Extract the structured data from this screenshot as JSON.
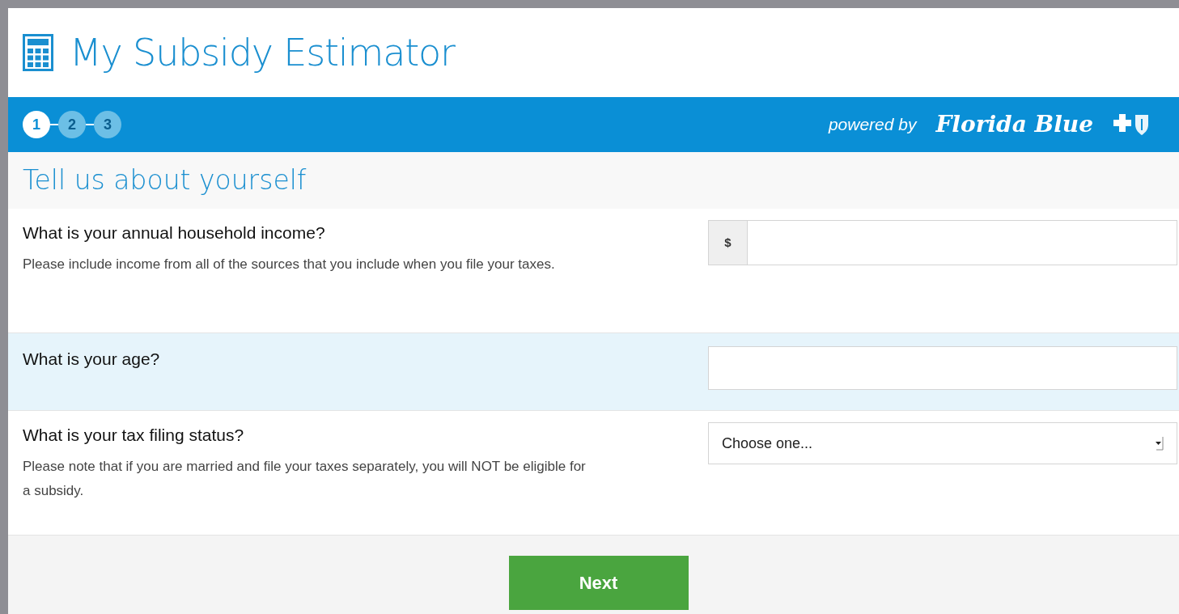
{
  "header": {
    "title": "My Subsidy Estimator"
  },
  "steps": [
    {
      "label": "1",
      "selected": true
    },
    {
      "label": "2",
      "selected": false
    },
    {
      "label": "3",
      "selected": false
    }
  ],
  "brand": {
    "powered_by": "powered by",
    "name": "Florida Blue"
  },
  "section_title": "Tell us about yourself",
  "questions": [
    {
      "kind": "prefixed",
      "question": "What is your annual household income?",
      "help": "Please include income from all of the sources that you include when you file your taxes.",
      "prefix": "$",
      "highlighted": false
    },
    {
      "kind": "text",
      "question": "What is your age?",
      "highlighted": true
    },
    {
      "kind": "select",
      "question": "What is your tax filing status?",
      "help": "Please note that if you are married and file your taxes separately, you will NOT be eligible for a subsidy.",
      "value": "Choose one...",
      "highlighted": false
    }
  ],
  "next_button": "Next"
}
